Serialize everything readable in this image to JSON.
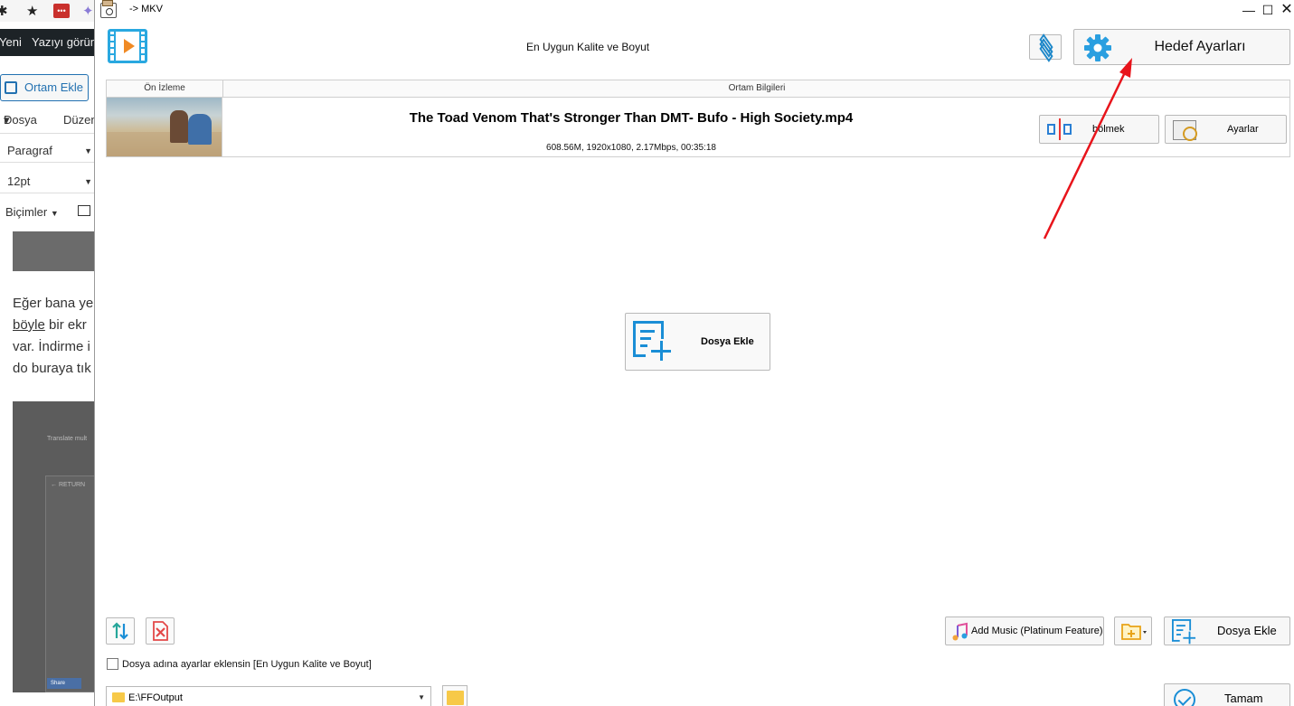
{
  "background": {
    "adminbar": {
      "new_label": "Yeni",
      "view_label": "Yazıyı görün"
    },
    "add_media_label": "Ortam Ekle",
    "menu": {
      "file_label": "Dosya",
      "edit_label": "Düzen"
    },
    "paragraph_label": "Paragraf",
    "font_size_label": "12pt",
    "formats_label": "Biçimler",
    "paragraph_lines": [
      "Eğer bana ye",
      "böyle",
      " bir ekr",
      "var. İndirme i",
      "do buraya tık"
    ],
    "shot_text_1": "Translate mult",
    "shot_text_2": "← RETURN",
    "shot_share": "Share"
  },
  "window": {
    "title": "-> MKV",
    "profile_title": "En Uygun Kalite ve Boyut",
    "target_settings_label": "Hedef Ayarları",
    "table": {
      "col_preview": "Ön İzleme",
      "col_media_info": "Ortam Bilgileri"
    },
    "file": {
      "name": "The Toad Venom That's Stronger Than DMT- Bufo - High Society.mp4",
      "meta": "608.56M, 1920x1080, 2.17Mbps, 00:35:18",
      "split_label": "bölmek",
      "settings_label": "Ayarlar"
    },
    "add_file_center_label": "Dosya Ekle",
    "add_music_label": "Add Music (Platinum Feature)",
    "add_file_label": "Dosya Ekle",
    "checkbox_label": "Dosya adına ayarlar eklensin [En Uygun Kalite ve Boyut]",
    "output_folder": "E:\\FFOutput",
    "ok_label": "Tamam"
  },
  "colors": {
    "accent_blue": "#1a8ed6",
    "annotation_arrow": "#e8141b",
    "folder_yellow": "#f7c948"
  }
}
